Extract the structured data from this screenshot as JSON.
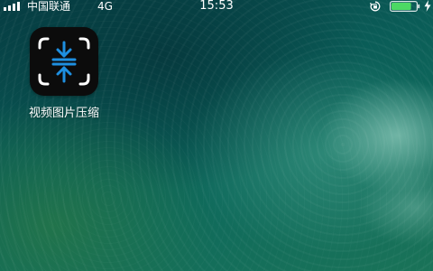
{
  "status_bar": {
    "carrier": "中国联通",
    "network": "4G",
    "time": "15:53",
    "signal_bars": 4,
    "battery_level": 0.8,
    "battery_color": "#4cd964"
  },
  "home_screen": {
    "apps": [
      {
        "label": "视频图片压缩",
        "icon": "compress-icon",
        "accent_color": "#1e8fe0"
      }
    ]
  }
}
